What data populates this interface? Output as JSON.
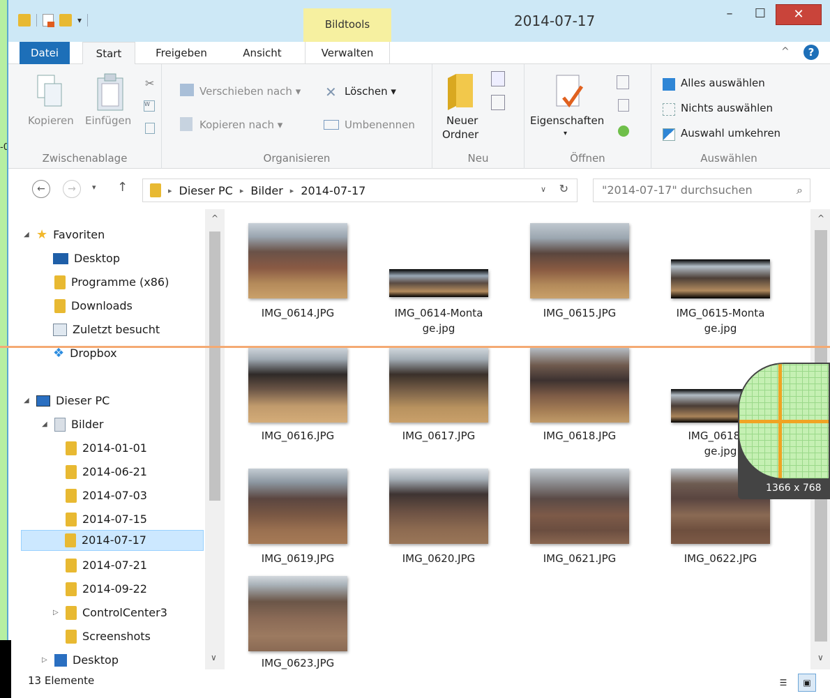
{
  "window": {
    "title": "2014-07-17",
    "context_tab": "Bildtools",
    "minimize": "–",
    "maximize": "☐",
    "close": "✕"
  },
  "tabs": [
    "Datei",
    "Start",
    "Freigeben",
    "Ansicht",
    "Verwalten"
  ],
  "ribbon": {
    "clipboard": {
      "copy": "Kopieren",
      "paste": "Einfügen",
      "label": "Zwischenablage"
    },
    "organize": {
      "move": "Verschieben nach",
      "copy_to": "Kopieren nach",
      "delete": "Löschen",
      "rename": "Umbenennen",
      "label": "Organisieren"
    },
    "new": {
      "folder_line1": "Neuer",
      "folder_line2": "Ordner",
      "label": "Neu"
    },
    "open": {
      "properties": "Eigenschaften",
      "label": "Öffnen"
    },
    "select": {
      "all": "Alles auswählen",
      "none": "Nichts auswählen",
      "invert": "Auswahl umkehren",
      "label": "Auswählen"
    }
  },
  "address": {
    "crumbs": [
      "Dieser PC",
      "Bilder",
      "2014-07-17"
    ],
    "search_placeholder": "\"2014-07-17\" durchsuchen"
  },
  "navpane": {
    "favorites": "Favoriten",
    "fav_items": [
      "Desktop",
      "Programme (x86)",
      "Downloads",
      "Zuletzt besucht",
      "Dropbox"
    ],
    "this_pc": "Dieser PC",
    "bilder": "Bilder",
    "folders": [
      "2014-01-01",
      "2014-06-21",
      "2014-07-03",
      "2014-07-15",
      "2014-07-17",
      "2014-07-21",
      "2014-09-22",
      "ControlCenter3",
      "Screenshots"
    ],
    "desktop": "Desktop",
    "selected": "2014-07-17"
  },
  "files": [
    {
      "name1": "IMG_0614.JPG",
      "name2": ""
    },
    {
      "name1": "IMG_0614-Monta",
      "name2": "ge.jpg"
    },
    {
      "name1": "IMG_0615.JPG",
      "name2": ""
    },
    {
      "name1": "IMG_0615-Monta",
      "name2": "ge.jpg"
    },
    {
      "name1": "IMG_0616.JPG",
      "name2": ""
    },
    {
      "name1": "IMG_0617.JPG",
      "name2": ""
    },
    {
      "name1": "IMG_0618.JPG",
      "name2": ""
    },
    {
      "name1": "IMG_0618-M",
      "name2": "ge.jpg"
    },
    {
      "name1": "IMG_0619.JPG",
      "name2": ""
    },
    {
      "name1": "IMG_0620.JPG",
      "name2": ""
    },
    {
      "name1": "IMG_0621.JPG",
      "name2": ""
    },
    {
      "name1": "IMG_0622.JPG",
      "name2": ""
    },
    {
      "name1": "IMG_0623.JPG",
      "name2": ""
    }
  ],
  "status": {
    "count": "13 Elemente"
  },
  "overlay": {
    "magnifier_label": "1366 x 768",
    "left_edge_text": "-0"
  }
}
